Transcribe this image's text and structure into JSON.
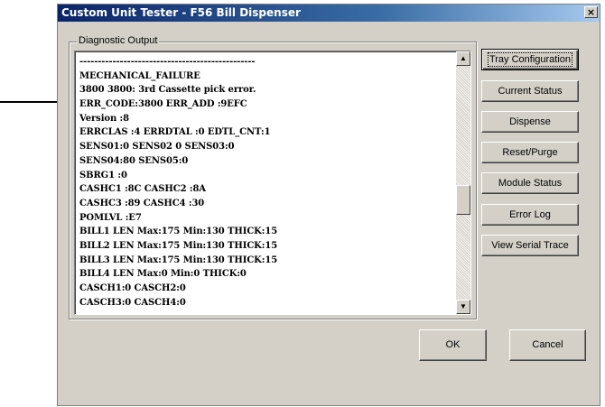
{
  "window": {
    "title": "Custom Unit Tester - F56 Bill Dispenser",
    "close_glyph": "×"
  },
  "group": {
    "label": "Diagnostic Output"
  },
  "output_lines": [
    "------------------------------------------------",
    "MECHANICAL_FAILURE",
    "3800 3800: 3rd Cassette pick error.",
    "ERR_CODE:3800 ERR_ADD :9EFC",
    "Version :8",
    "ERRCLAS :4 ERRDTAL :0 EDTL_CNT:1",
    "SENS01:0 SENS02 0 SENS03:0",
    "SENS04:80 SENS05:0",
    "SBRG1   :0",
    "CASHC1  :8C CASHC2  :8A",
    "CASHC3  :89 CASHC4  :30",
    "POMLVL  :E7",
    "BILL1 LEN Max:175 Min:130 THICK:15",
    "BILL2 LEN Max:175 Min:130 THICK:15",
    "BILL3 LEN Max:175 Min:130 THICK:15",
    "BILL4 LEN Max:0 Min:0 THICK:0",
    "CASCH1:0 CASCH2:0",
    "CASCH3:0 CASCH4:0"
  ],
  "scrollbar": {
    "up_glyph": "▲",
    "down_glyph": "▼"
  },
  "buttons": {
    "tray_configuration": "Tray Configuration",
    "current_status": "Current Status",
    "dispense": "Dispense",
    "reset_purge": "Reset/Purge",
    "module_status": "Module Status",
    "error_log": "Error Log",
    "view_serial_trace": "View Serial Trace",
    "ok": "OK",
    "cancel": "Cancel"
  }
}
